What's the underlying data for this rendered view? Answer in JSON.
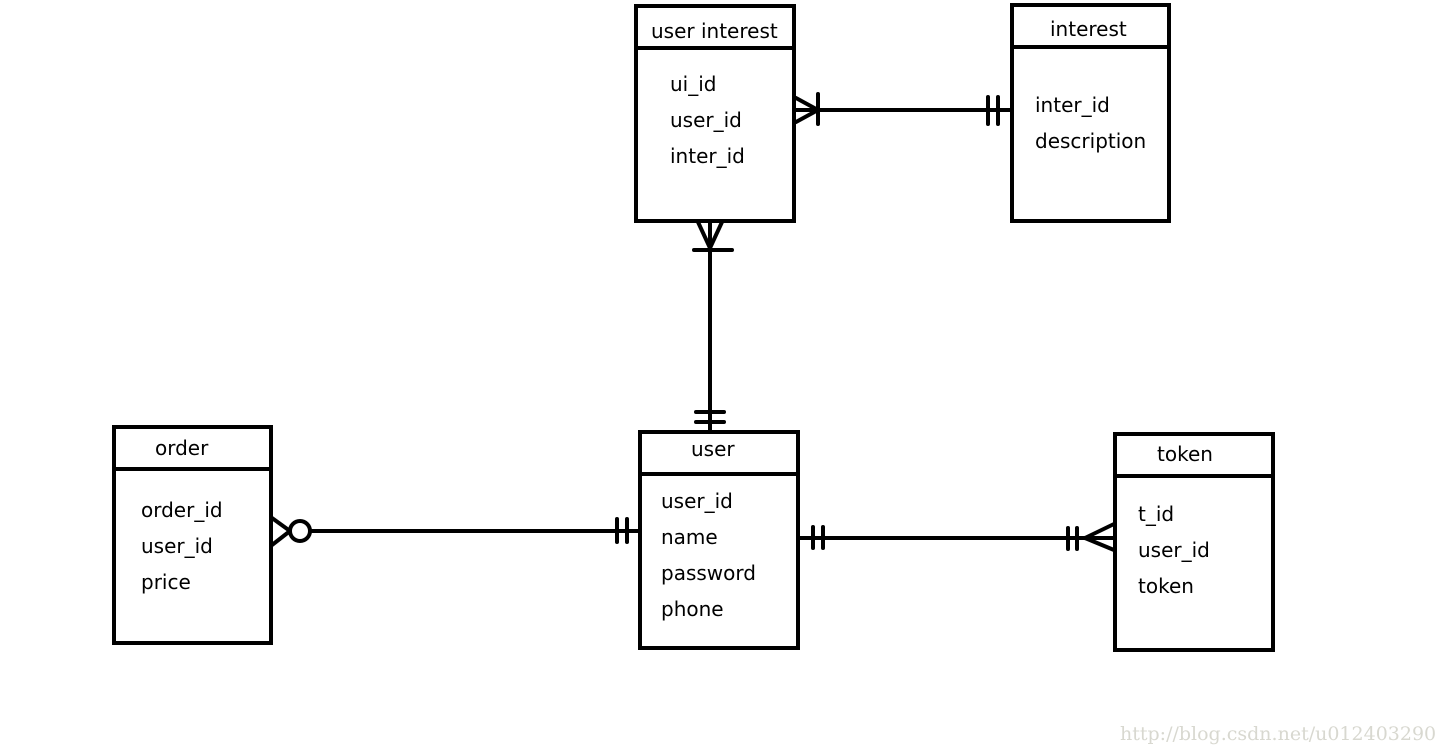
{
  "diagram": {
    "type": "entity-relationship",
    "entities": {
      "user_interest": {
        "title": "user interest",
        "attributes": [
          "ui_id",
          "user_id",
          "inter_id"
        ]
      },
      "interest": {
        "title": "interest",
        "attributes": [
          "inter_id",
          "description"
        ]
      },
      "user": {
        "title": "user",
        "attributes": [
          "user_id",
          "name",
          "password",
          "phone"
        ]
      },
      "order": {
        "title": "order",
        "attributes": [
          "order_id",
          "user_id",
          "price"
        ]
      },
      "token": {
        "title": "token",
        "attributes": [
          "t_id",
          "user_id",
          "token"
        ]
      }
    },
    "relationships": [
      {
        "from": "user_interest",
        "to": "interest",
        "from_cardinality": "one-or-many",
        "to_cardinality": "exactly-one"
      },
      {
        "from": "user_interest",
        "to": "user",
        "from_cardinality": "one-or-many",
        "to_cardinality": "exactly-one"
      },
      {
        "from": "order",
        "to": "user",
        "from_cardinality": "zero-or-many",
        "to_cardinality": "exactly-one"
      },
      {
        "from": "user",
        "to": "token",
        "from_cardinality": "exactly-one",
        "to_cardinality": "one-or-many"
      }
    ],
    "watermark": "http://blog.csdn.net/u012403290"
  }
}
